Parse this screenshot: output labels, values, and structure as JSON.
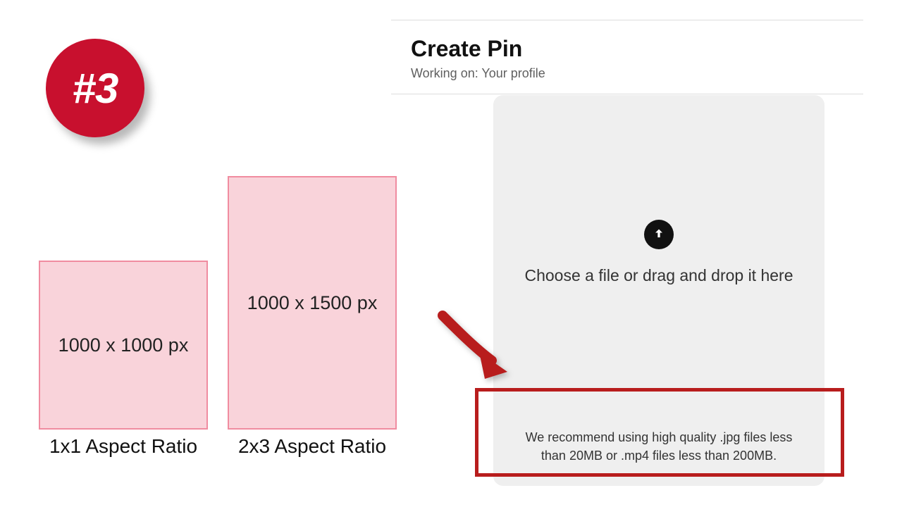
{
  "badge": {
    "label": "#3"
  },
  "aspect_cards": {
    "card_1x1": {
      "dim": "1000 x 1000 px",
      "label": "1x1 Aspect Ratio"
    },
    "card_2x3": {
      "dim": "1000 x 1500 px",
      "label": "2x3 Aspect Ratio"
    }
  },
  "create_pin": {
    "title": "Create Pin",
    "subtitle": "Working on: Your profile",
    "drop_text": "Choose a file or drag and drop it here",
    "note": "We recommend using high quality .jpg files less than 20MB or .mp4 files less than 200MB."
  }
}
